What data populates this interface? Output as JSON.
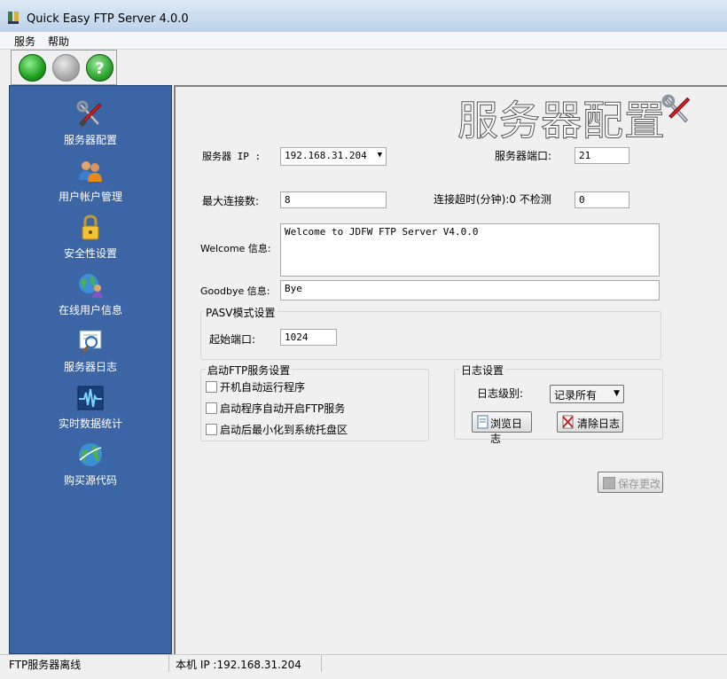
{
  "window": {
    "title": "Quick Easy FTP Server 4.0.0"
  },
  "menu": {
    "items": [
      "服务",
      "帮助"
    ]
  },
  "toolbar": {
    "buttons": [
      "start-green",
      "stop-gray",
      "help-green"
    ]
  },
  "sidebar": {
    "items": [
      {
        "label": "服务器配置",
        "icon": "tools-icon"
      },
      {
        "label": "用户帐户管理",
        "icon": "users-icon"
      },
      {
        "label": "安全性设置",
        "icon": "lock-icon"
      },
      {
        "label": "在线用户信息",
        "icon": "globe-user-icon"
      },
      {
        "label": "服务器日志",
        "icon": "log-icon"
      },
      {
        "label": "实时数据统计",
        "icon": "pulse-icon"
      },
      {
        "label": "购买源代码",
        "icon": "globe-icon"
      }
    ]
  },
  "main": {
    "banner": "服务器配置",
    "server_ip_label": "服务器 IP :",
    "server_ip_value": "192.168.31.204",
    "port_label": "服务器端口:",
    "port_value": "21",
    "max_conn_label": "最大连接数:",
    "max_conn_value": "8",
    "timeout_label": "连接超时(分钟):0 不检测",
    "timeout_value": "0",
    "welcome_label": "Welcome 信息:",
    "welcome_value": "Welcome to JDFW  FTP Server V4.0.0",
    "goodbye_label": "Goodbye 信息:",
    "goodbye_value": "Bye",
    "pasv": {
      "title": "PASV模式设置",
      "start_port_label": "起始端口:",
      "start_port_value": "1024"
    },
    "startup": {
      "title": "启动FTP服务设置",
      "options": [
        {
          "label": "开机自动运行程序",
          "checked": false
        },
        {
          "label": "启动程序自动开启FTP服务",
          "checked": false
        },
        {
          "label": "启动后最小化到系统托盘区",
          "checked": false
        }
      ]
    },
    "log": {
      "title": "日志设置",
      "level_label": "日志级别:",
      "level_value": "记录所有",
      "browse_label": "浏览日志",
      "clear_label": "清除日志"
    },
    "save_label": "保存更改"
  },
  "status": {
    "state": "FTP服务器离线",
    "local_ip": "本机 IP :192.168.31.204"
  }
}
